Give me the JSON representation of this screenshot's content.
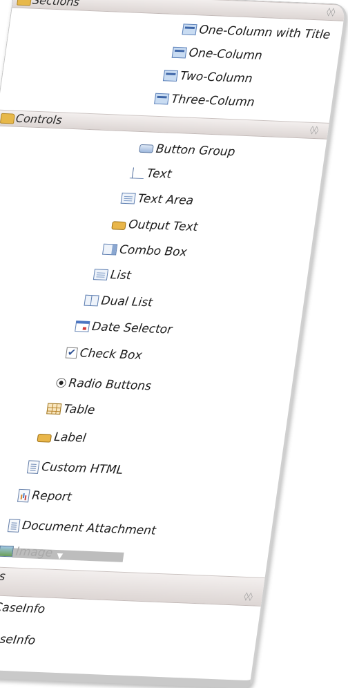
{
  "palette": {
    "sections_header": {
      "title": "Sections",
      "collapse_icon": "double-chevron-icon",
      "items": [
        {
          "label": "One-Column with Title",
          "icon": "layout-icon"
        },
        {
          "label": "One-Column",
          "icon": "layout-icon"
        },
        {
          "label": "Two-Column",
          "icon": "layout-icon"
        },
        {
          "label": "Three-Column",
          "icon": "layout-icon"
        }
      ]
    },
    "controls_header": {
      "title": "Controls",
      "collapse_icon": "double-chevron-icon",
      "items": [
        {
          "label": "Button Group",
          "icon": "button-group-icon"
        },
        {
          "label": "Text",
          "icon": "text-field-icon"
        },
        {
          "label": "Text Area",
          "icon": "text-area-icon"
        },
        {
          "label": "Output Text",
          "icon": "output-text-icon"
        },
        {
          "label": "Combo Box",
          "icon": "combo-box-icon"
        },
        {
          "label": "List",
          "icon": "list-icon"
        },
        {
          "label": "Dual List",
          "icon": "dual-list-icon"
        },
        {
          "label": "Date Selector",
          "icon": "date-selector-icon"
        },
        {
          "label": "Check Box",
          "icon": "checkbox-icon"
        },
        {
          "label": "Radio Buttons",
          "icon": "radio-button-icon"
        },
        {
          "label": "Table",
          "icon": "table-icon"
        },
        {
          "label": "Label",
          "icon": "label-icon"
        },
        {
          "label": "Custom HTML",
          "icon": "custom-html-icon"
        },
        {
          "label": "Report",
          "icon": "report-icon"
        },
        {
          "label": "Document Attachment",
          "icon": "document-icon"
        },
        {
          "label": "Image",
          "icon": "image-icon"
        }
      ]
    },
    "variables_header": {
      "title": "Variables",
      "collapse_icon": "double-chevron-icon",
      "items": [
        {
          "label": "CaseInfo",
          "icon": "input-variable-icon"
        },
        {
          "label": "caseInfo",
          "icon": "variable-dot-icon"
        }
      ]
    },
    "scroll_indicator": "▼",
    "checkmark": "✔"
  }
}
